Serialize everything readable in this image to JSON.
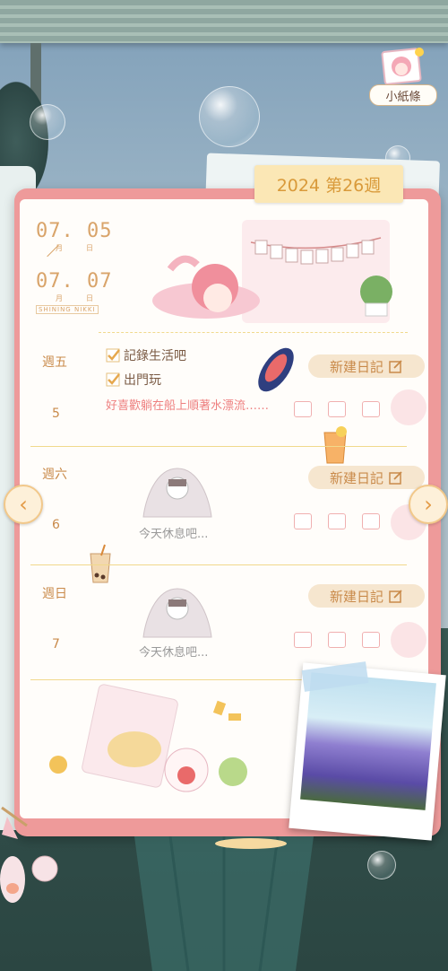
{
  "top_right": {
    "note_label": "小紙條"
  },
  "planner": {
    "week_title": "2024 第26週",
    "date_start": {
      "day": "07. 05",
      "sub_month": "月",
      "sub_day": "日"
    },
    "date_end": {
      "day": "07. 07",
      "sub_month": "月",
      "sub_day": "日"
    },
    "brand": "SHINING NIKKI",
    "days": [
      {
        "label": "週五",
        "num": "5",
        "button_label": "新建日記",
        "todos": [
          "記錄生活吧",
          "出門玩"
        ],
        "entry": "好喜歡躺在船上順著水漂流……"
      },
      {
        "label": "週六",
        "num": "6",
        "button_label": "新建日記",
        "rest_text": "今天休息吧..."
      },
      {
        "label": "週日",
        "num": "7",
        "button_label": "新建日記",
        "rest_text": "今天休息吧..."
      }
    ]
  },
  "nav": {
    "prev_icon": "‹",
    "next_icon": "›"
  },
  "colors": {
    "accent": "#d99a3a",
    "frame": "#ee9a9a",
    "checkbox": "#f0b0b0",
    "entry_text": "#ee8080"
  }
}
